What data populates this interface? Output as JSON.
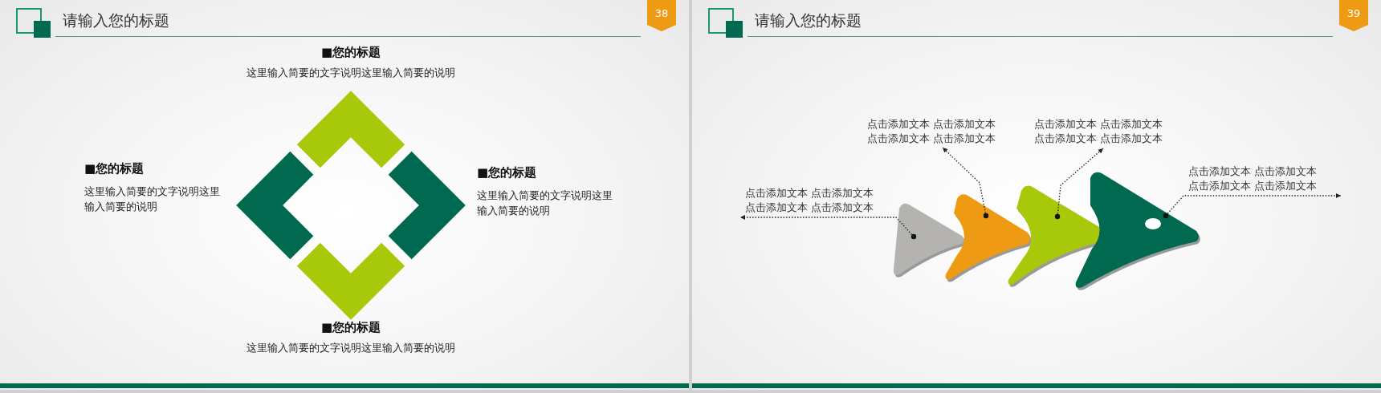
{
  "slides": [
    {
      "number": "38",
      "title": "请输入您的标题",
      "kind": "diamond",
      "items": [
        {
          "heading": "■您的标题",
          "text": "这里输入简要的文字说明这里输入简要的说明"
        },
        {
          "heading": "■您的标题",
          "text": "这里输入简要的文字说明这里输入简要的说明"
        },
        {
          "heading": "■您的标题",
          "text": "这里输入简要的文字说明这里输入简要的说明"
        },
        {
          "heading": "■您的标题",
          "text": "这里输入简要的文字说明这里输入简要的说明"
        }
      ]
    },
    {
      "number": "39",
      "title": "请输入您的标题",
      "kind": "arrows",
      "callouts": [
        {
          "lines": [
            "点击添加文本 点击添加文本",
            "点击添加文本 点击添加文本"
          ]
        },
        {
          "lines": [
            "点击添加文本 点击添加文本",
            "点击添加文本 点击添加文本"
          ]
        },
        {
          "lines": [
            "点击添加文本 点击添加文本",
            "点击添加文本 点击添加文本"
          ]
        },
        {
          "lines": [
            "点击添加文本 点击添加文本",
            "点击添加文本 点击添加文本"
          ]
        }
      ]
    }
  ]
}
